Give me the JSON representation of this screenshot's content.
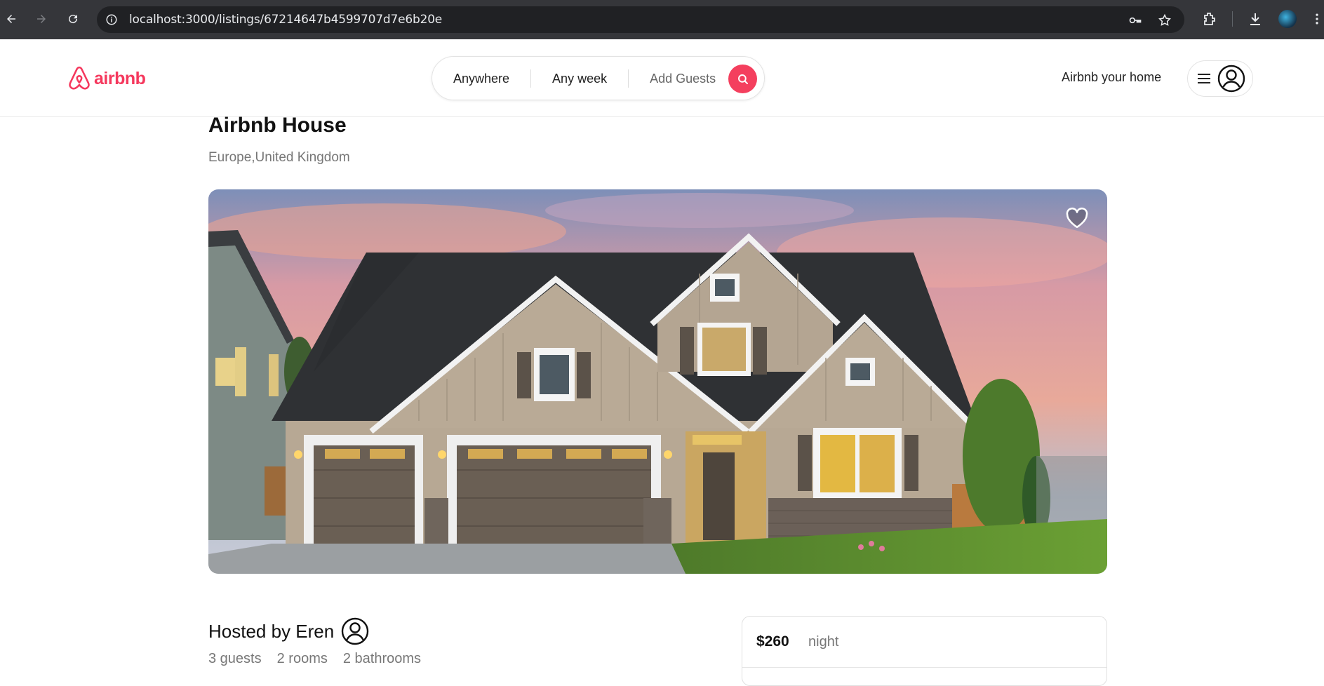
{
  "browser": {
    "url": "localhost:3000/listings/67214647b4599707d7e6b20e"
  },
  "header": {
    "logo_text": "airbnb",
    "search": {
      "location": "Anywhere",
      "week": "Any week",
      "guests": "Add Guests"
    },
    "host_link": "Airbnb your home"
  },
  "listing": {
    "title": "Airbnb House",
    "location": "Europe,United Kingdom",
    "hosted_by": "Hosted by Eren",
    "guests": "3 guests",
    "rooms": "2 rooms",
    "bathrooms": "2 bathrooms",
    "price": "$260",
    "price_unit": "night"
  },
  "colors": {
    "brand": "#F43F5E",
    "chrome_bg": "#35363a",
    "url_bg": "#202124"
  }
}
